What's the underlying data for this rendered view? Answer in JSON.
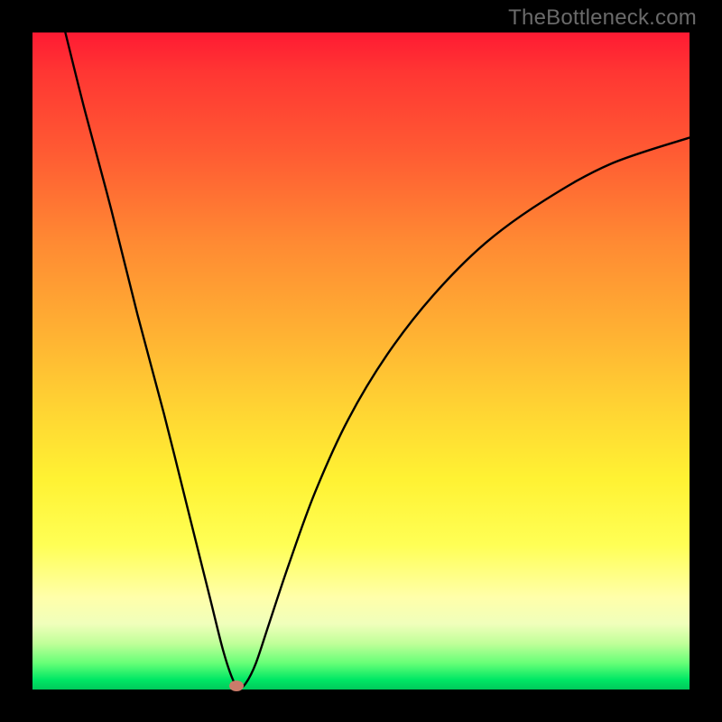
{
  "attribution": "TheBottleneck.com",
  "chart_data": {
    "type": "line",
    "title": "",
    "xlabel": "",
    "ylabel": "",
    "xlim": [
      0,
      100
    ],
    "ylim": [
      0,
      100
    ],
    "grid": false,
    "legend": false,
    "series": [
      {
        "name": "bottleneck-curve",
        "x": [
          5,
          8,
          12,
          16,
          20,
          24,
          27,
          29,
          30.5,
          31.5,
          32.5,
          34,
          36,
          39,
          43,
          48,
          54,
          61,
          69,
          78,
          88,
          100
        ],
        "values": [
          100,
          88,
          73,
          57,
          42,
          26,
          14,
          6,
          1.5,
          0.3,
          1.0,
          4,
          10,
          19,
          30,
          41,
          51,
          60,
          68,
          74.5,
          80,
          84
        ]
      }
    ],
    "marker": {
      "x": 31.0,
      "y": 0.6,
      "color": "#cb7b6a"
    },
    "background_gradient": {
      "stops": [
        {
          "pos": 0.0,
          "color": "#ff1a33"
        },
        {
          "pos": 0.5,
          "color": "#ffd633"
        },
        {
          "pos": 0.86,
          "color": "#ffffaa"
        },
        {
          "pos": 1.0,
          "color": "#00c95b"
        }
      ]
    }
  },
  "colors": {
    "frame": "#000000",
    "curve": "#000000",
    "marker": "#cb7b6a",
    "attribution_text": "#6a6a6a"
  }
}
